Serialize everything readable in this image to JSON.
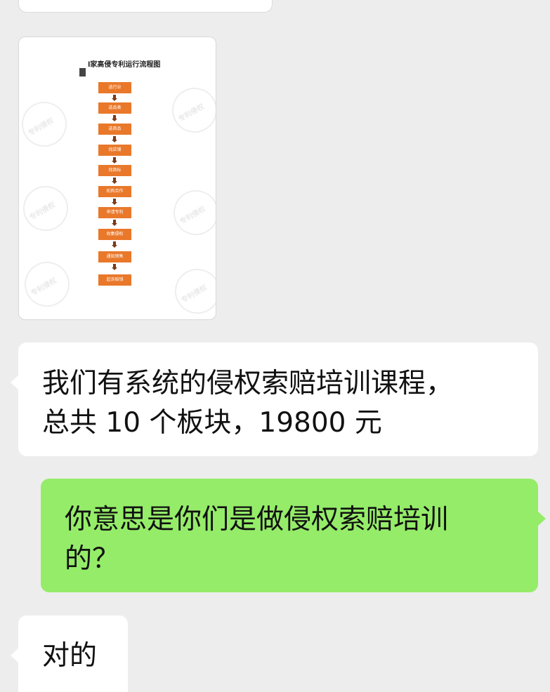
{
  "image_message": {
    "title": "l家高侵专利运行流程图",
    "steps": [
      "选行业",
      "选品类",
      "选商品",
      "找店铺",
      "找商标",
      "机构合作",
      "申请专利",
      "收集侵权",
      "通知销售",
      "起诉赔钱"
    ],
    "watermark": "专利侵权",
    "colors": {
      "step_fill": "#e9782a",
      "arrow": "#7a3a18"
    }
  },
  "messages": [
    {
      "side": "left",
      "lines": [
        "我们有系统的侵权索赔培训课程，",
        "总共 10 个板块，19800 元"
      ]
    },
    {
      "side": "right",
      "lines": [
        "你意思是你们是做侵权索赔培训",
        "的？"
      ]
    },
    {
      "side": "left",
      "lines": [
        "对的"
      ]
    }
  ],
  "colors": {
    "background": "#ededed",
    "incoming_bubble": "#ffffff",
    "outgoing_bubble": "#95ec69"
  }
}
